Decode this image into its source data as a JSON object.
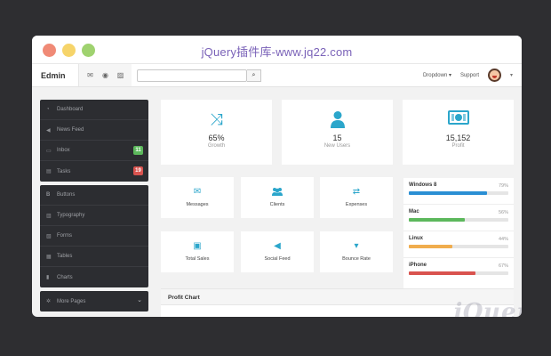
{
  "window_title": "jQuery插件库-www.jq22.com",
  "navbar": {
    "brand": "Edmin",
    "icons": [
      "envelope-icon",
      "eye-icon",
      "image-icon"
    ],
    "search_value": "",
    "search_icon": "search-icon",
    "dropdown_label": "Dropdown ▾",
    "support_label": "Support"
  },
  "sidebar": {
    "group1": [
      {
        "label": "Dashboard",
        "icon": "dashboard-icon"
      },
      {
        "label": "News Feed",
        "icon": "bullhorn-icon"
      },
      {
        "label": "Inbox",
        "icon": "inbox-icon",
        "badge": "11",
        "badge_color": "#5cb85c"
      },
      {
        "label": "Tasks",
        "icon": "tasks-icon",
        "badge": "19",
        "badge_color": "#d9534f"
      }
    ],
    "group2": [
      {
        "label": "Buttons",
        "icon": "bold-icon"
      },
      {
        "label": "Typography",
        "icon": "book-icon"
      },
      {
        "label": "Forms",
        "icon": "paste-icon"
      },
      {
        "label": "Tables",
        "icon": "table-icon"
      },
      {
        "label": "Charts",
        "icon": "bar-chart-icon"
      }
    ],
    "group3": [
      {
        "label": "More Pages",
        "icon": "cog-icon"
      }
    ]
  },
  "stats": [
    {
      "value": "65%",
      "label": "Growth",
      "icon": "shuffle-icon"
    },
    {
      "value": "15",
      "label": "New Users",
      "icon": "user-icon"
    },
    {
      "value": "15,152",
      "label": "Profit",
      "icon": "money-icon"
    }
  ],
  "tiles": [
    {
      "label": "Messages",
      "icon": "envelope-icon"
    },
    {
      "label": "Clients",
      "icon": "group-icon"
    },
    {
      "label": "Expenses",
      "icon": "exchange-icon"
    },
    {
      "label": "Total Sales",
      "icon": "save-icon"
    },
    {
      "label": "Social Feed",
      "icon": "bullhorn-icon"
    },
    {
      "label": "Bounce Rate",
      "icon": "sort-down-icon"
    }
  ],
  "os_stats": [
    {
      "name": "Windows 8",
      "percent": 79,
      "percent_label": "79%",
      "color": "#2a8fd4"
    },
    {
      "name": "Mac",
      "percent": 56,
      "percent_label": "56%",
      "color": "#5cb85c"
    },
    {
      "name": "Linux",
      "percent": 44,
      "percent_label": "44%",
      "color": "#f0ad4e"
    },
    {
      "name": "iPhone",
      "percent": 67,
      "percent_label": "67%",
      "color": "#d9534f"
    }
  ],
  "profit_chart": {
    "title": "Profit Chart"
  },
  "watermark": "jQuery",
  "colors": {
    "accent": "#2ba6cb",
    "sidebar_bg": "#2c2d31"
  }
}
